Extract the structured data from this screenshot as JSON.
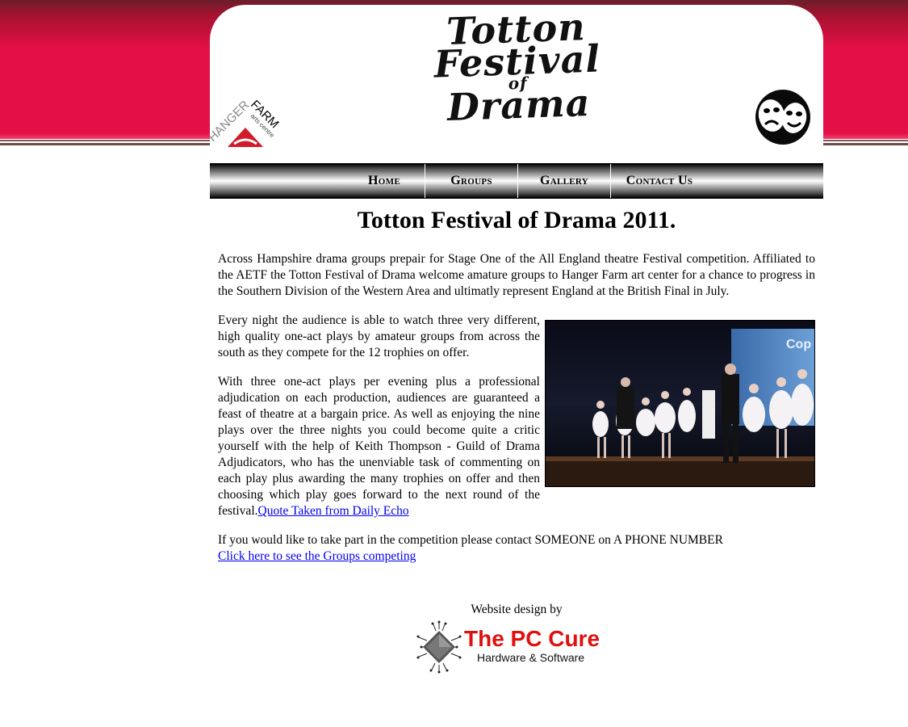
{
  "header": {
    "logo_line1": "Totton",
    "logo_line2": "Festival",
    "logo_line3": "of",
    "logo_line4": "Drama",
    "hanger_logo_word1": "HANGER",
    "hanger_logo_word2": "FARM",
    "hanger_logo_word3": "arts centre"
  },
  "nav": {
    "items": [
      {
        "label": "Home"
      },
      {
        "label": "Groups"
      },
      {
        "label": "Gallery"
      },
      {
        "label": "Contact Us"
      }
    ]
  },
  "main": {
    "title": "Totton Festival of Drama 2011.",
    "para1": "Across Hampshire drama groups prepair for Stage One of the All England theatre Festival competition. Affiliated to the AETF the Totton Festival of Drama welcome amature groups to Hanger Farm art center for a chance to progress in the Southern Division of the Western Area and ultimatly represent England at the British Final in July.",
    "para2": "Every night the audience is able to watch three very different, high quality one-act plays by amateur groups from across the south as they compete for the 12 trophies on offer.",
    "para3": "With three one-act plays per evening plus a professional adjudication on each production, audiences are guaranteed a feast of theatre at a bargain price. As well as enjoying the nine plays over the three nights you could become quite a critic yourself with the help of Keith Thompson - Guild of Drama Adjudicators, who has the unenviable task of commenting on each play plus awarding the many trophies on offer and then choosing which play goes forward to the next round of the festival.",
    "quote_link": "Quote Taken from Daily Echo",
    "contact_text": "If you would like to take part in the competition please contact SOMEONE on A PHONE NUMBER",
    "groups_link": "Click here to see the Groups competing",
    "photo_sign_text": "Cop"
  },
  "footer": {
    "design_by": "Website design by",
    "brand": "The PC Cure",
    "tagline": "Hardware & Software"
  },
  "colors": {
    "band": "#e40f47",
    "link": "#0000ee",
    "brand_red": "#e01010"
  }
}
